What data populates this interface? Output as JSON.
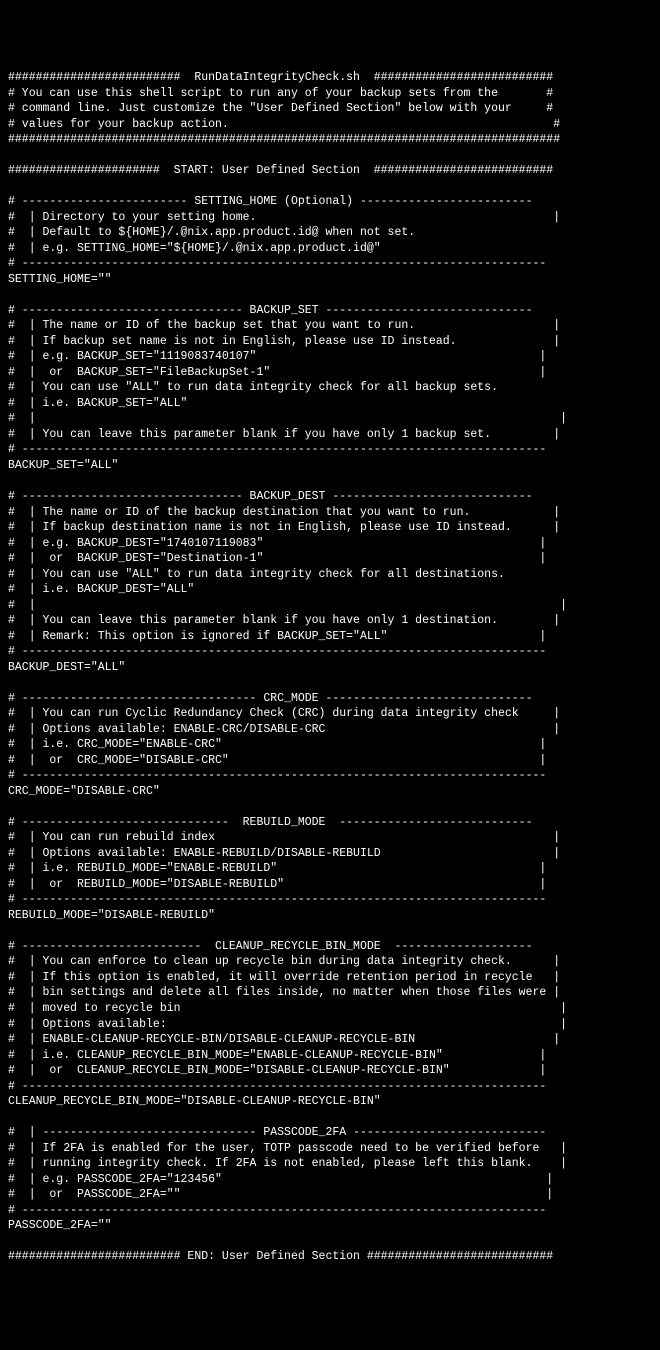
{
  "script": {
    "title_line": "#########################  RunDataIntegrityCheck.sh  ##########################",
    "header_l1": "# You can use this shell script to run any of your backup sets from the       #",
    "header_l2": "# command line. Just customize the \"User Defined Section\" below with your     #",
    "header_l3": "# values for your backup action.                                               #",
    "header_l4": "################################################################################",
    "blank": "",
    "start_section": "######################  START: User Defined Section  ##########################",
    "setting_home": {
      "h": "# ------------------------ SETTING_HOME (Optional) -------------------------",
      "l1": "#  | Directory to your setting home.                                           |",
      "l2": "#  | Default to ${HOME}/.@nix.app.product.id@ when not set.",
      "l3": "#  | e.g. SETTING_HOME=\"${HOME}/.@nix.app.product.id@\"",
      "f": "# ----------------------------------------------------------------------------",
      "val": "SETTING_HOME=\"\""
    },
    "backup_set": {
      "h": "# -------------------------------- BACKUP_SET ------------------------------",
      "l1": "#  | The name or ID of the backup set that you want to run.                    |",
      "l2": "#  | If backup set name is not in English, please use ID instead.              |",
      "l3": "#  | e.g. BACKUP_SET=\"1119083740107\"                                         |",
      "l4": "#  |  or  BACKUP_SET=\"FileBackupSet-1\"                                       |",
      "l5": "#  | You can use \"ALL\" to run data integrity check for all backup sets.",
      "l6": "#  | i.e. BACKUP_SET=\"ALL\"",
      "l7": "#  |                                                                            |",
      "l8": "#  | You can leave this parameter blank if you have only 1 backup set.         |",
      "f": "# ----------------------------------------------------------------------------",
      "val": "BACKUP_SET=\"ALL\""
    },
    "backup_dest": {
      "h": "# -------------------------------- BACKUP_DEST -----------------------------",
      "l1": "#  | The name or ID of the backup destination that you want to run.            |",
      "l2": "#  | If backup destination name is not in English, please use ID instead.      |",
      "l3": "#  | e.g. BACKUP_DEST=\"1740107119083\"                                        |",
      "l4": "#  |  or  BACKUP_DEST=\"Destination-1\"                                        |",
      "l5": "#  | You can use \"ALL\" to run data integrity check for all destinations.",
      "l6": "#  | i.e. BACKUP_DEST=\"ALL\"",
      "l7": "#  |                                                                            |",
      "l8": "#  | You can leave this parameter blank if you have only 1 destination.        |",
      "l9": "#  | Remark: This option is ignored if BACKUP_SET=\"ALL\"                      |",
      "f": "# ----------------------------------------------------------------------------",
      "val": "BACKUP_DEST=\"ALL\""
    },
    "crc_mode": {
      "h": "# ---------------------------------- CRC_MODE ------------------------------",
      "l1": "#  | You can run Cyclic Redundancy Check (CRC) during data integrity check     |",
      "l2": "#  | Options available: ENABLE-CRC/DISABLE-CRC                                 |",
      "l3": "#  | i.e. CRC_MODE=\"ENABLE-CRC\"                                              |",
      "l4": "#  |  or  CRC_MODE=\"DISABLE-CRC\"                                             |",
      "f": "# ----------------------------------------------------------------------------",
      "val": "CRC_MODE=\"DISABLE-CRC\""
    },
    "rebuild_mode": {
      "h": "# ------------------------------  REBUILD_MODE  ----------------------------",
      "l1": "#  | You can run rebuild index                                                 |",
      "l2": "#  | Options available: ENABLE-REBUILD/DISABLE-REBUILD                         |",
      "l3": "#  | i.e. REBUILD_MODE=\"ENABLE-REBUILD\"                                      |",
      "l4": "#  |  or  REBUILD_MODE=\"DISABLE-REBUILD\"                                     |",
      "f": "# ----------------------------------------------------------------------------",
      "val": "REBUILD_MODE=\"DISABLE-REBUILD\""
    },
    "cleanup_mode": {
      "h": "# --------------------------  CLEANUP_RECYCLE_BIN_MODE  --------------------",
      "l1": "#  | You can enforce to clean up recycle bin during data integrity check.      |",
      "l2": "#  | If this option is enabled, it will override retention period in recycle   |",
      "l3": "#  | bin settings and delete all files inside, no matter when those files were |",
      "l4": "#  | moved to recycle bin                                                       |",
      "l5": "#  | Options available:                                                         |",
      "l6": "#  | ENABLE-CLEANUP-RECYCLE-BIN/DISABLE-CLEANUP-RECYCLE-BIN                    |",
      "l7": "#  | i.e. CLEANUP_RECYCLE_BIN_MODE=\"ENABLE-CLEANUP-RECYCLE-BIN\"              |",
      "l8": "#  |  or  CLEANUP_RECYCLE_BIN_MODE=\"DISABLE-CLEANUP-RECYCLE-BIN\"             |",
      "f": "# ----------------------------------------------------------------------------",
      "val": "CLEANUP_RECYCLE_BIN_MODE=\"DISABLE-CLEANUP-RECYCLE-BIN\""
    },
    "passcode_2fa": {
      "h": "#  | ------------------------------- PASSCODE_2FA ----------------------------",
      "l1": "#  | If 2FA is enabled for the user, TOTP passcode need to be verified before   |",
      "l2": "#  | running integrity check. If 2FA is not enabled, please left this blank.    |",
      "l3": "#  | e.g. PASSCODE_2FA=\"123456\"                                               |",
      "l4": "#  |  or  PASSCODE_2FA=\"\"                                                     |",
      "f": "# ----------------------------------------------------------------------------",
      "val": "PASSCODE_2FA=\"\""
    },
    "end_section": "######################### END: User Defined Section ###########################"
  }
}
